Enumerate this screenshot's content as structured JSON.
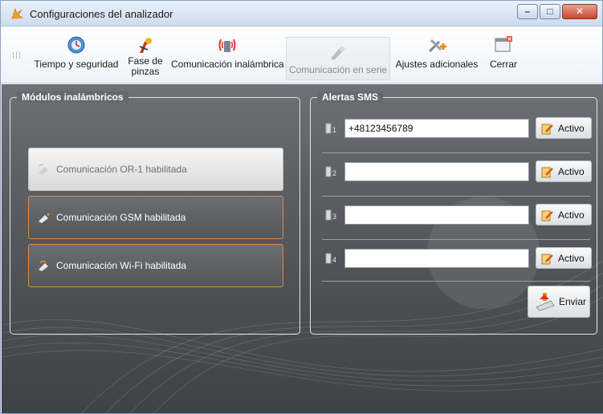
{
  "window": {
    "title": "Configuraciones del analizador",
    "controls": {
      "minimize": "–",
      "maximize": "□",
      "close": "✕"
    }
  },
  "toolbar": {
    "grip": "⁞⁞⁞",
    "items": [
      {
        "label": "Tiempo y seguridad",
        "icon": "clock-shield-icon"
      },
      {
        "label": "Fase de\npinzas",
        "icon": "clamp-phase-icon"
      },
      {
        "label": "Comunicación inalámbrica",
        "icon": "wireless-icon"
      },
      {
        "label": "Comunicación en serie",
        "icon": "serial-plug-icon",
        "disabled": true
      },
      {
        "label": "Ajustes adicionales",
        "icon": "tools-plus-icon"
      },
      {
        "label": "Cerrar",
        "icon": "close-window-icon"
      }
    ]
  },
  "modules": {
    "title": "Módulos inalámbricos",
    "buttons": [
      {
        "label": "Comunicación OR-1 habilitada",
        "state": "inactive"
      },
      {
        "label": "Comunicación GSM habilitada",
        "state": "active"
      },
      {
        "label": "Comunicación Wi-Fi habilitada",
        "state": "active"
      }
    ]
  },
  "sms": {
    "title": "Alertas SMS",
    "rows": [
      {
        "index": "1",
        "value": "+48123456789",
        "button": "Activo"
      },
      {
        "index": "2",
        "value": "",
        "button": "Activo"
      },
      {
        "index": "3",
        "value": "",
        "button": "Activo"
      },
      {
        "index": "4",
        "value": "",
        "button": "Activo"
      }
    ],
    "send_label": "Enviar"
  },
  "colors": {
    "active_border": "#d98b43",
    "panel_bg": "#5c5f64"
  }
}
